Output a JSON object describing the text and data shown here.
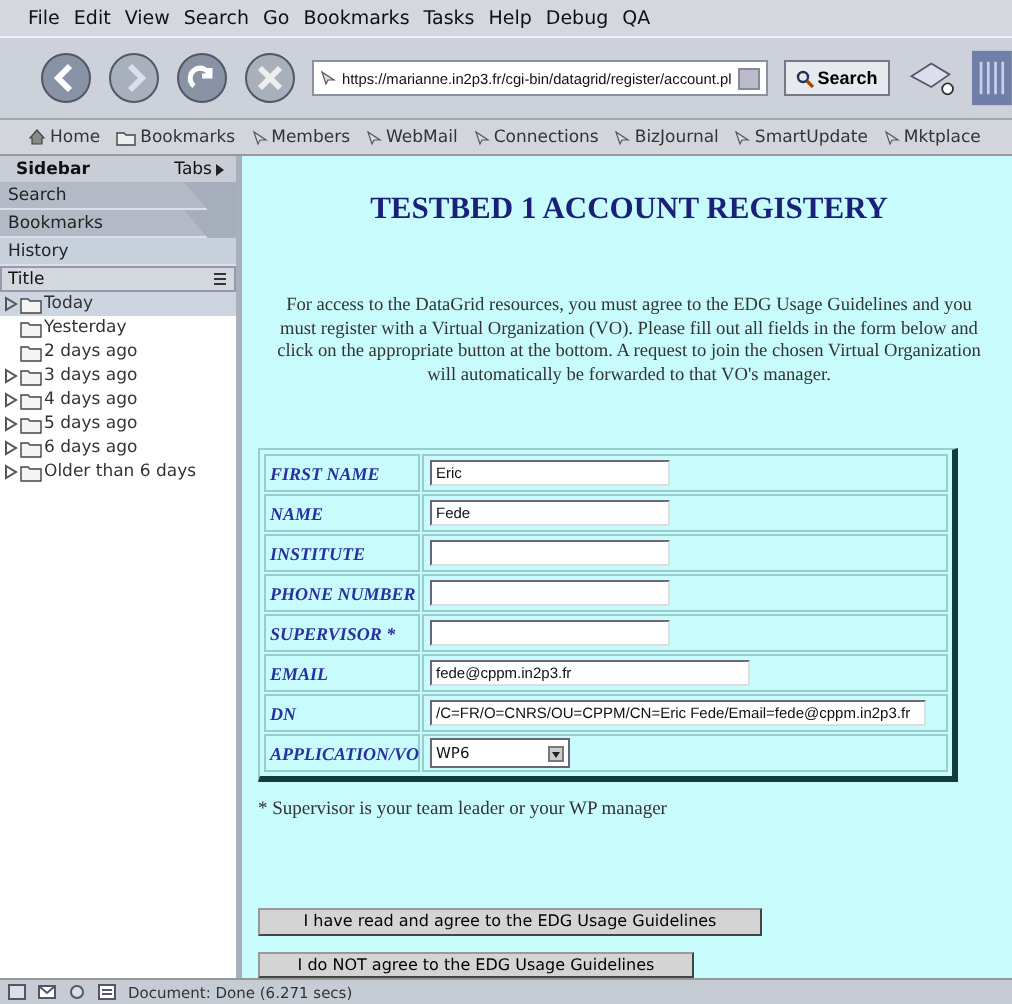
{
  "menu": [
    "File",
    "Edit",
    "View",
    "Search",
    "Go",
    "Bookmarks",
    "Tasks",
    "Help",
    "Debug",
    "QA"
  ],
  "navigation": {
    "url": "https://marianne.in2p3.fr/cgi-bin/datagrid/register/account.pl",
    "search_button": "Search"
  },
  "bookmarks": [
    {
      "label": "Home",
      "kind": "home"
    },
    {
      "label": "Bookmarks",
      "kind": "folder"
    },
    {
      "label": "Members",
      "kind": "link"
    },
    {
      "label": "WebMail",
      "kind": "link"
    },
    {
      "label": "Connections",
      "kind": "link"
    },
    {
      "label": "BizJournal",
      "kind": "link"
    },
    {
      "label": "SmartUpdate",
      "kind": "link"
    },
    {
      "label": "Mktplace",
      "kind": "link"
    }
  ],
  "sidebar": {
    "title": "Sidebar",
    "tabs_label": "Tabs",
    "tabs": [
      {
        "label": "Search",
        "selected": false
      },
      {
        "label": "Bookmarks",
        "selected": false
      },
      {
        "label": "History",
        "selected": true
      }
    ],
    "column": "Title",
    "history": [
      {
        "label": "Today",
        "expandable": true,
        "selected": true
      },
      {
        "label": "Yesterday",
        "expandable": false,
        "selected": false
      },
      {
        "label": "2 days ago",
        "expandable": false,
        "selected": false
      },
      {
        "label": "3 days ago",
        "expandable": true,
        "selected": false
      },
      {
        "label": "4 days ago",
        "expandable": true,
        "selected": false
      },
      {
        "label": "5 days ago",
        "expandable": true,
        "selected": false
      },
      {
        "label": "6 days ago",
        "expandable": true,
        "selected": false
      },
      {
        "label": "Older than 6 days",
        "expandable": true,
        "selected": false
      }
    ]
  },
  "page": {
    "title": "TESTBED 1 ACCOUNT REGISTERY",
    "intro": "For access to the DataGrid resources, you must agree to the EDG Usage Guidelines and you must register with a Virtual Organization (VO). Please fill out all fields in the form below and click on the appropriate button at the bottom. A request to join the chosen Virtual Organization will automatically be forwarded to that VO's manager.",
    "fields": [
      {
        "label": "FIRST NAME",
        "kind": "text",
        "value": "Eric"
      },
      {
        "label": "NAME",
        "kind": "text",
        "value": "Fede"
      },
      {
        "label": "INSTITUTE",
        "kind": "text"
      },
      {
        "label": "PHONE NUMBER",
        "kind": "text"
      },
      {
        "label": "SUPERVISOR *",
        "kind": "text"
      },
      {
        "label": "EMAIL",
        "kind": "text",
        "value": "fede@cppm.in2p3.fr"
      },
      {
        "label": "DN",
        "kind": "text",
        "value": "/C=FR/O=CNRS/OU=CPPM/CN=Eric Fede/Email=fede@cppm.in2p3.fr"
      },
      {
        "label": "APPLICATION/VO",
        "kind": "select",
        "value": "WP6"
      }
    ],
    "note": "* Supervisor is your team leader or your WP manager",
    "buttons": [
      "I have read and agree to the EDG Usage Guidelines",
      "I do NOT agree to the EDG Usage Guidelines"
    ]
  },
  "status_bar": {
    "text": "Document: Done (6.271 secs)"
  }
}
